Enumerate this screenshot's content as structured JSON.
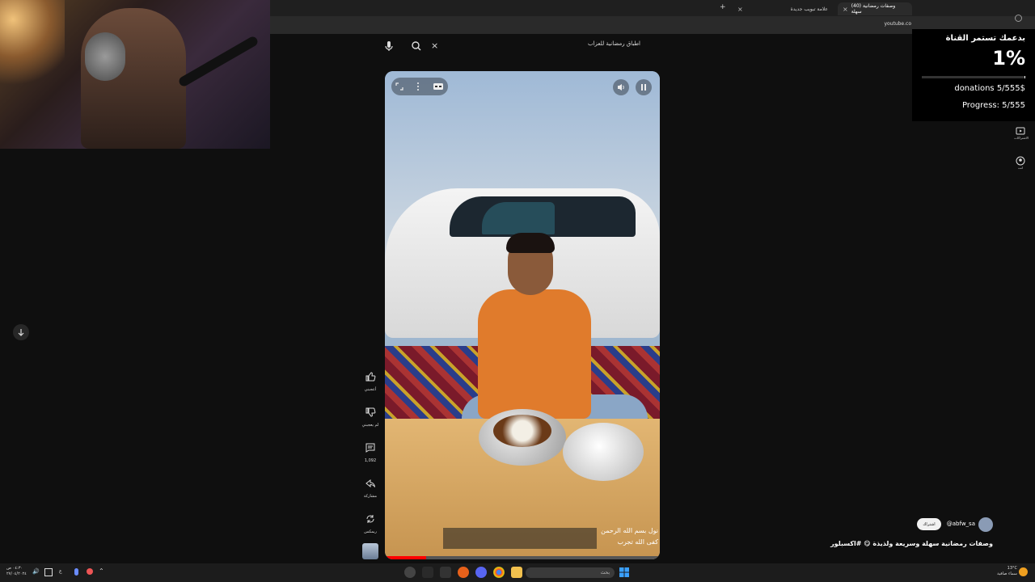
{
  "browser": {
    "tabs": [
      {
        "label": "(40) وصفات رمضانية سهلة",
        "active": true
      },
      {
        "label": "علامة تبويب جديدة",
        "active": false
      }
    ],
    "new_tab": "+",
    "url": "youtube.co"
  },
  "search": {
    "query": "اطباق رمضانية للعزاب",
    "clear": "×"
  },
  "video": {
    "subtitle_line1": "نول بسم الله الرحمن",
    "subtitle_line2": "كفى الله تجرب",
    "progress": 0.15
  },
  "actions": [
    {
      "icon": "like-icon",
      "label": "أعجبني"
    },
    {
      "icon": "dislike-icon",
      "label": "لم يعجبني"
    },
    {
      "icon": "comment-icon",
      "label": "1,092"
    },
    {
      "icon": "share-icon",
      "label": "مشاركة"
    },
    {
      "icon": "remix-icon",
      "label": "ريمكس"
    }
  ],
  "donation": {
    "title": "بدعمك تستمر القناة",
    "percent": "1%",
    "progress": 0.01,
    "amount": "donations 5/555$",
    "progress_text": "Progress: 5/555"
  },
  "sidebar": {
    "subscriptions": "الاشتراكات",
    "you": "انت"
  },
  "channel": {
    "handle": "@abfw_sa",
    "subscribe": "اشتراك",
    "title": "وصفات رمضانية سهلة وسريعة ولذيذة 😋 #اكسبلور"
  },
  "taskbar": {
    "time": "٠٤:٣٠ ص",
    "date": "٢٧/٠٤/٢٠٢٤",
    "search_placeholder": "بحث",
    "weather_temp": "13°C",
    "weather_desc": "سماء صافية",
    "lang": "ع"
  }
}
